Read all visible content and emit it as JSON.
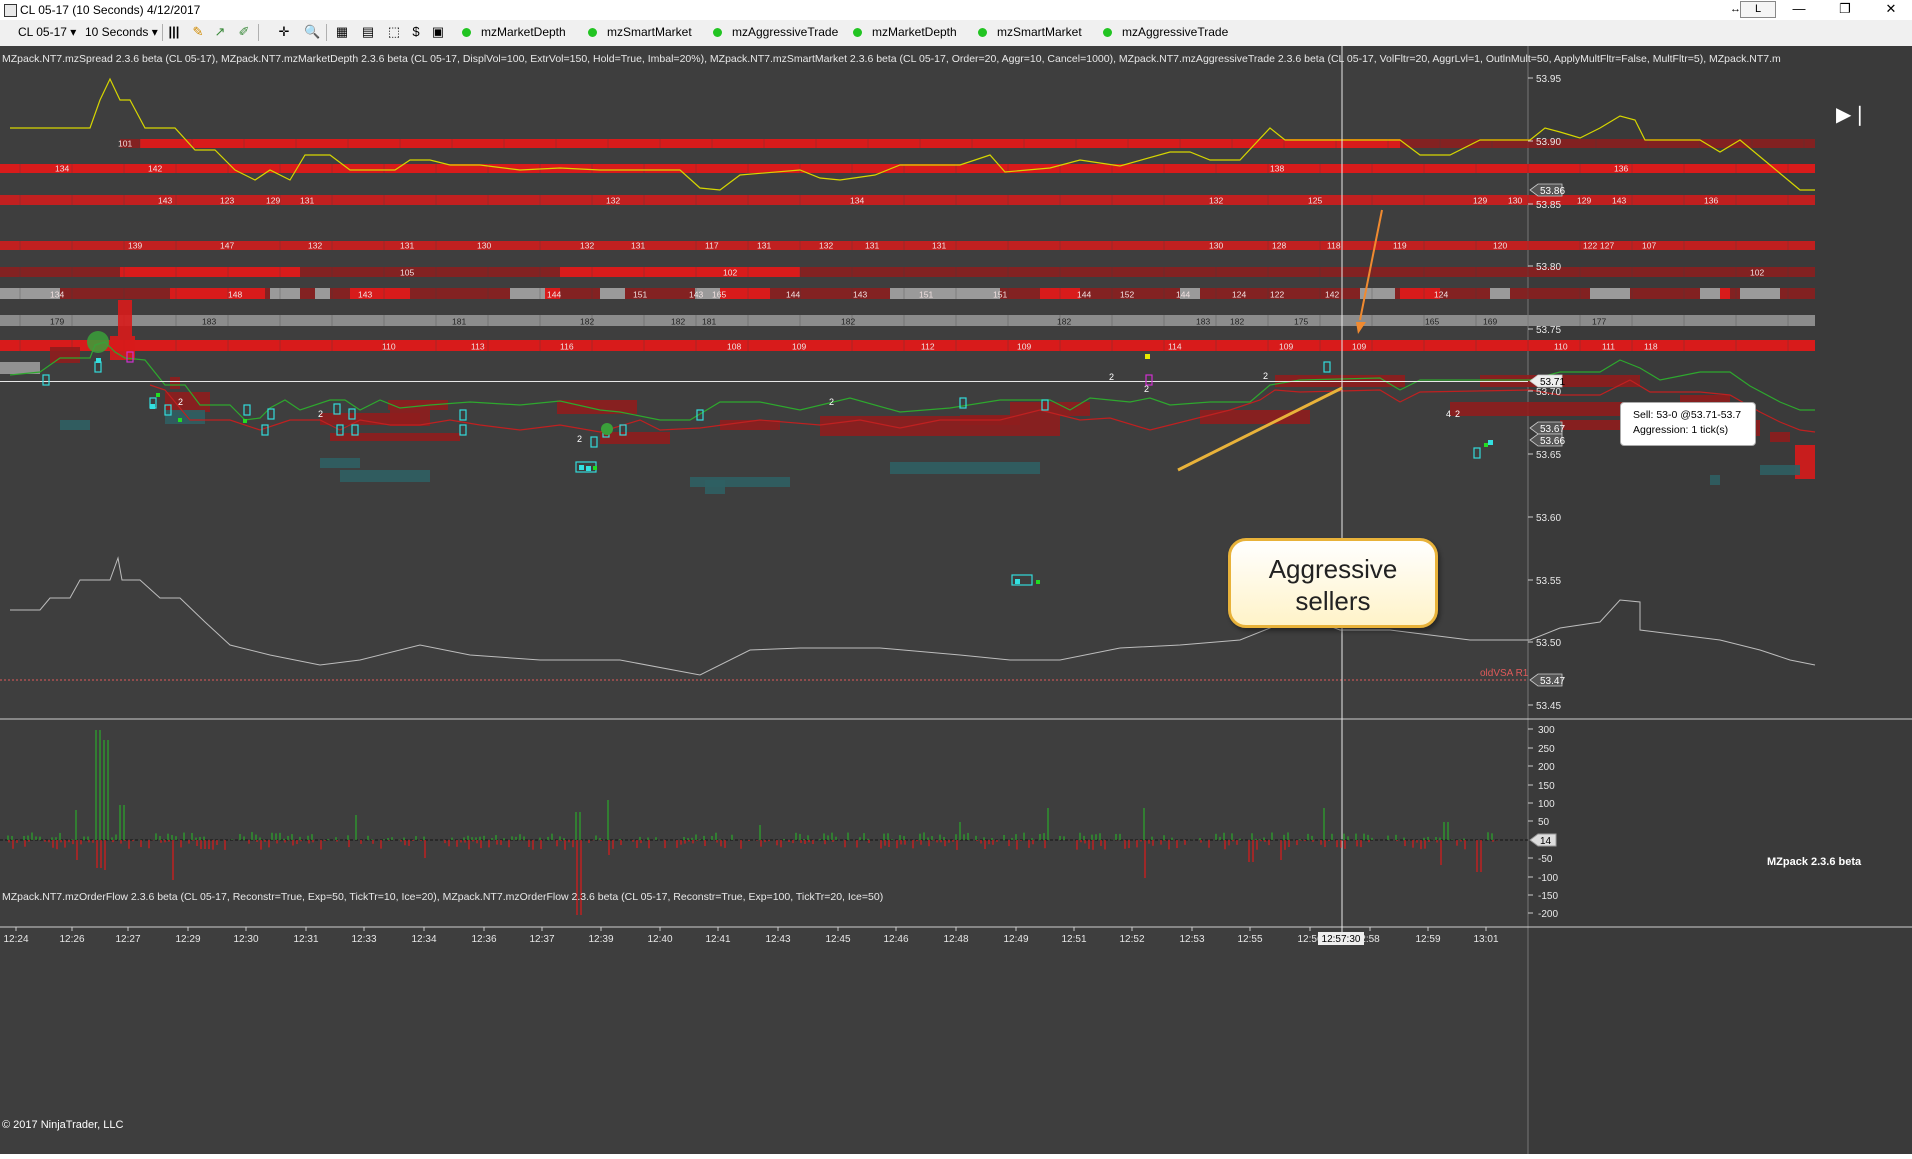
{
  "window": {
    "title": "CL 05-17 (10 Seconds)  4/12/2017",
    "link_label": "L",
    "minimize": "—",
    "maximize": "❐",
    "close": "✕"
  },
  "toolbar": {
    "instrument": "CL 05-17",
    "interval": "10 Seconds",
    "indicators": [
      "mzMarketDepth",
      "mzSmartMarket",
      "mzAggressiveTrade",
      "mzMarketDepth",
      "mzSmartMarket",
      "mzAggressiveTrade"
    ],
    "indicator_status_color": "#22c422"
  },
  "price_panel": {
    "indicator_label": "MZpack.NT7.mzSpread 2.3.6 beta (CL 05-17), MZpack.NT7.mzMarketDepth 2.3.6 beta (CL 05-17, DisplVol=100, ExtrVol=150, Hold=True, Imbal=20%), MZpack.NT7.mzSmartMarket 2.3.6 beta (CL 05-17, Order=20, Aggr=10, Cancel=1000), MZpack.NT7.mzAggressiveTrade 2.3.6 beta (CL 05-17, VolFltr=20, AggrLvl=1, OutlnMult=50, ApplyMultFltr=False, MultFltr=5), MZpack.NT7.m",
    "price_ticks": [
      "53.95",
      "53.90",
      "53.85",
      "53.80",
      "53.75",
      "53.70",
      "53.65",
      "53.60",
      "53.55",
      "53.50",
      "53.45"
    ],
    "price_markers": [
      "53.86",
      "53.71",
      "53.67",
      "53.66",
      "53.47"
    ],
    "ask_levels": [
      {
        "price": "53.93",
        "labels": [
          "101"
        ]
      },
      {
        "price": "53.91",
        "labels": [
          "134",
          "142",
          "138",
          "136"
        ]
      },
      {
        "price": "53.88",
        "labels": [
          "143",
          "123",
          "129",
          "131",
          "132",
          "134",
          "132",
          "125",
          "129",
          "130",
          "129",
          "143",
          "136"
        ]
      },
      {
        "price": "53.86",
        "labels": [
          "139",
          "147",
          "132",
          "131",
          "130",
          "132",
          "131",
          "117",
          "131",
          "132",
          "131",
          "131",
          "130",
          "128",
          "118",
          "119",
          "120",
          "122",
          "107",
          "127"
        ]
      },
      {
        "price": "53.83",
        "labels": [
          "105",
          "102",
          "102"
        ]
      },
      {
        "price": "53.82",
        "labels": [
          "134",
          "148",
          "143",
          "144",
          "151",
          "143",
          "165",
          "144",
          "143",
          "151",
          "151",
          "144",
          "152",
          "144",
          "124",
          "122",
          "142",
          "124"
        ]
      },
      {
        "price": "53.80",
        "labels": [
          "179",
          "183",
          "181",
          "182",
          "182",
          "181",
          "182",
          "182",
          "183",
          "182",
          "175",
          "165",
          "169",
          "177"
        ]
      },
      {
        "price": "53.78",
        "labels": [
          "110",
          "113",
          "116",
          "108",
          "109",
          "112",
          "109",
          "114",
          "109",
          "109",
          "110",
          "111",
          "118"
        ]
      }
    ],
    "trade_counts": [
      "2",
      "2",
      "2",
      "2",
      "2",
      "2",
      "2",
      "4",
      "2"
    ],
    "tooltip": {
      "line1": "Sell: 53-0 @53.71-53.7",
      "line2": "Aggression: 1 tick(s)"
    },
    "callout": {
      "line1": "Aggressive",
      "line2": "sellers"
    },
    "oldvsa_label": "oldVSA R1",
    "watermark": "MZpack 2.3.6 beta"
  },
  "orderflow_panel": {
    "indicator_label": "MZpack.NT7.mzOrderFlow 2.3.6 beta (CL 05-17, Reconstr=True, Exp=50, TickTr=10, Ice=20), MZpack.NT7.mzOrderFlow 2.3.6 beta (CL 05-17, Reconstr=True, Exp=100, TickTr=20, Ice=50)",
    "axis_ticks": [
      "300",
      "250",
      "200",
      "150",
      "100",
      "50",
      "-50",
      "-100",
      "-150",
      "-200"
    ],
    "zero_marker": "14"
  },
  "time_axis": {
    "labels": [
      "12:24",
      "12:26",
      "12:27",
      "12:29",
      "12:30",
      "12:31",
      "12:33",
      "12:34",
      "12:36",
      "12:37",
      "12:39",
      "12:40",
      "12:41",
      "12:43",
      "12:45",
      "12:46",
      "12:48",
      "12:49",
      "12:51",
      "12:52",
      "12:53",
      "12:55",
      "12:56",
      "2:58",
      "12:59",
      "13:01"
    ],
    "cursor_time": "12:57:30"
  },
  "copyright": "© 2017 NinjaTrader, LLC",
  "colors": {
    "background": "#3e3e3e",
    "ask_dark": "#8f1d1d",
    "ask_bright": "#d81b1b",
    "bid_teal": "#2f5f63",
    "grey_level": "#9a9a9a",
    "yellow_line": "#d6d600",
    "green_line": "#2ea82e",
    "red_line": "#c02020",
    "callout_border": "#e8b23a",
    "arrow": "#f08a30"
  }
}
